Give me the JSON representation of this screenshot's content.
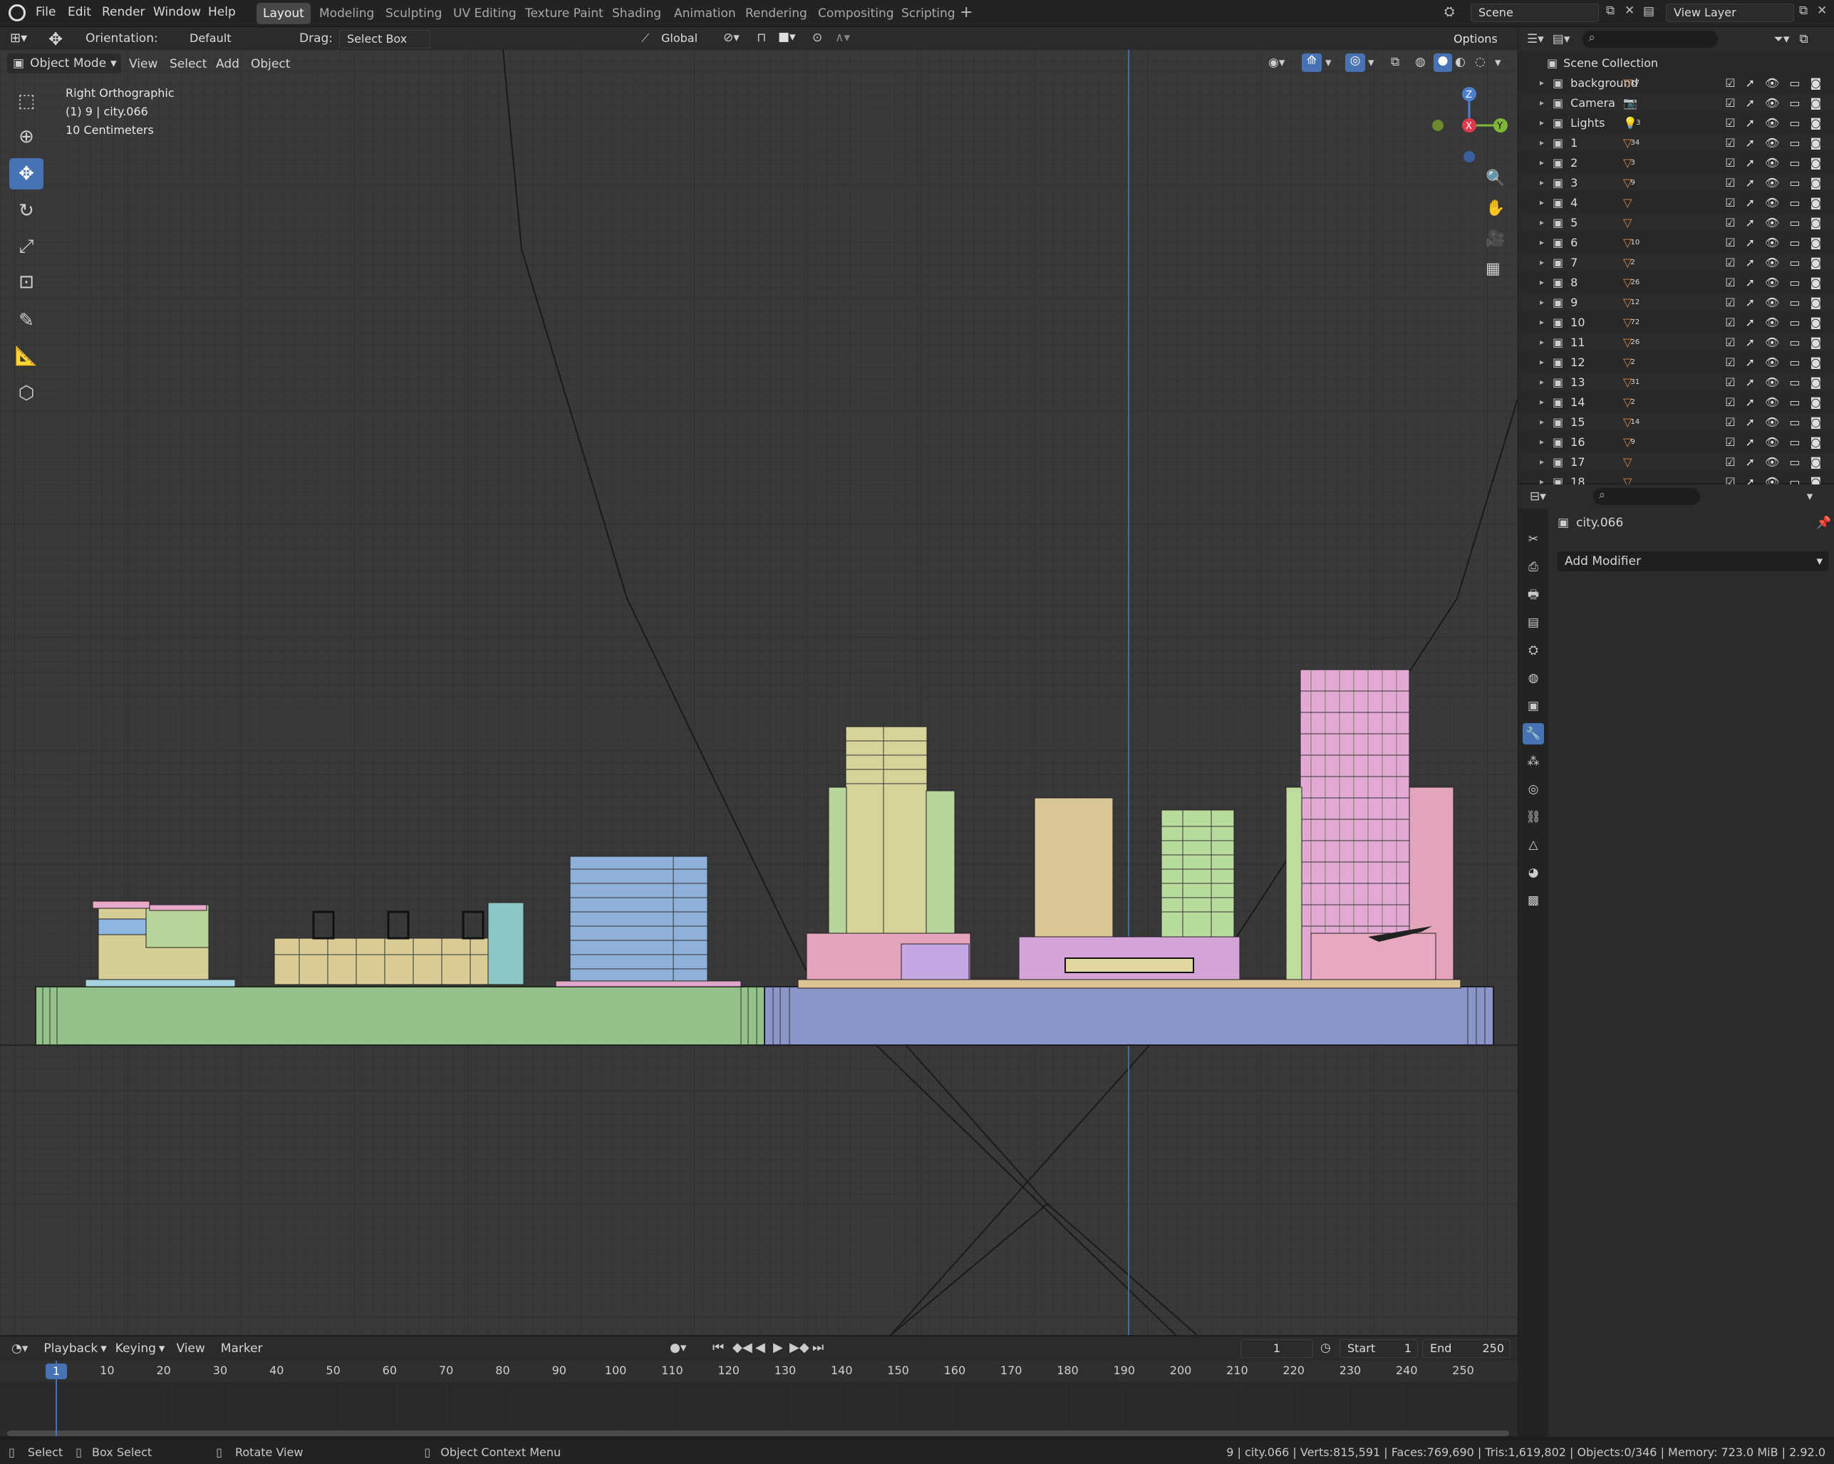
{
  "topbar": {
    "menus": [
      "File",
      "Edit",
      "Render",
      "Window",
      "Help"
    ],
    "workspaces": [
      "Layout",
      "Modeling",
      "Sculpting",
      "UV Editing",
      "Texture Paint",
      "Shading",
      "Animation",
      "Rendering",
      "Compositing",
      "Scripting"
    ],
    "active_workspace": "Layout",
    "scene_label": "Scene",
    "view_layer_label": "View Layer"
  },
  "tool_header": {
    "orientation_label": "Orientation:",
    "orientation_value": "Default",
    "drag_label": "Drag:",
    "drag_value": "Select Box",
    "transform_orientation": "Global",
    "options_label": "Options"
  },
  "viewport_header": {
    "mode": "Object Mode",
    "menus": [
      "View",
      "Select",
      "Add",
      "Object"
    ]
  },
  "viewport_overlay": {
    "view_name": "Right Orthographic",
    "object_info": "(1) 9 | city.066",
    "grid_scale": "10 Centimeters"
  },
  "gizmo": {
    "z": "Z",
    "x": "X",
    "y": "Y"
  },
  "outliner": {
    "root": "Scene Collection",
    "items": [
      {
        "name": "background",
        "badge": "17"
      },
      {
        "name": "Camera",
        "badge": ""
      },
      {
        "name": "Lights",
        "badge": "3"
      },
      {
        "name": "1",
        "badge": "34"
      },
      {
        "name": "2",
        "badge": "3"
      },
      {
        "name": "3",
        "badge": "9"
      },
      {
        "name": "4",
        "badge": ""
      },
      {
        "name": "5",
        "badge": ""
      },
      {
        "name": "6",
        "badge": "10"
      },
      {
        "name": "7",
        "badge": "2"
      },
      {
        "name": "8",
        "badge": "26"
      },
      {
        "name": "9",
        "badge": "12"
      },
      {
        "name": "10",
        "badge": "72"
      },
      {
        "name": "11",
        "badge": "26"
      },
      {
        "name": "12",
        "badge": "2"
      },
      {
        "name": "13",
        "badge": "31"
      },
      {
        "name": "14",
        "badge": "2"
      },
      {
        "name": "15",
        "badge": "14"
      },
      {
        "name": "16",
        "badge": "9"
      },
      {
        "name": "17",
        "badge": ""
      },
      {
        "name": "18",
        "badge": ""
      }
    ]
  },
  "properties": {
    "object_name": "city.066",
    "add_modifier": "Add Modifier"
  },
  "timeline": {
    "menus": [
      "Playback",
      "Keying",
      "View",
      "Marker"
    ],
    "current_frame": "1",
    "start_label": "Start",
    "start_value": "1",
    "end_label": "End",
    "end_value": "250",
    "ruler": [
      "1",
      "10",
      "20",
      "30",
      "40",
      "50",
      "60",
      "70",
      "80",
      "90",
      "100",
      "110",
      "120",
      "130",
      "140",
      "150",
      "160",
      "170",
      "180",
      "190",
      "200",
      "210",
      "220",
      "230",
      "240",
      "250"
    ]
  },
  "statusbar": {
    "select": "Select",
    "box_select": "Box Select",
    "rotate_view": "Rotate View",
    "context_menu": "Object Context Menu",
    "stats": "9 | city.066 | Verts:815,591 | Faces:769,690 | Tris:1,619,802 | Objects:0/346 | Memory: 723.0 MiB | 2.92.0"
  },
  "colors": {
    "accent": "#4772b3",
    "green_platform": "#94c08a",
    "blue_platform": "#8a95c8",
    "object_orange": "#e2863c"
  }
}
